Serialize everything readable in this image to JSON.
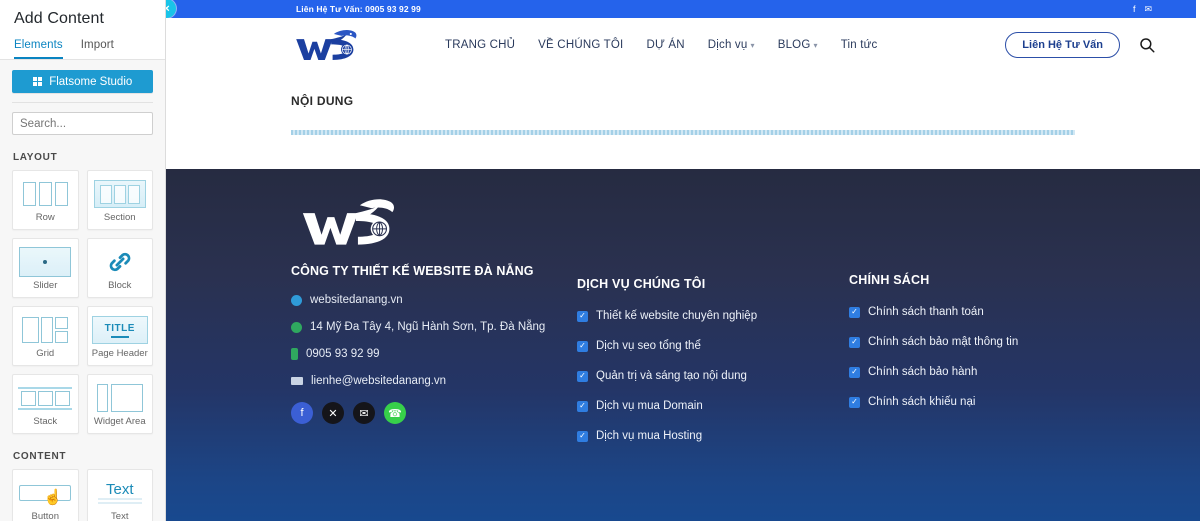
{
  "sidebar": {
    "title": "Add Content",
    "tabs": [
      {
        "label": "Elements",
        "active": true
      },
      {
        "label": "Import",
        "active": false
      }
    ],
    "studio_button": "Flatsome Studio",
    "search_placeholder": "Search...",
    "sections": [
      {
        "heading": "LAYOUT",
        "items": [
          {
            "label": "Row",
            "icon": "row-thumb-icon"
          },
          {
            "label": "Section",
            "icon": "section-thumb-icon"
          },
          {
            "label": "Slider",
            "icon": "slider-thumb-icon"
          },
          {
            "label": "Block",
            "icon": "link-thumb-icon"
          },
          {
            "label": "Grid",
            "icon": "grid-thumb-icon"
          },
          {
            "label": "Page Header",
            "icon": "page-header-thumb-icon"
          },
          {
            "label": "Stack",
            "icon": "stack-thumb-icon"
          },
          {
            "label": "Widget Area",
            "icon": "widget-area-thumb-icon"
          }
        ]
      },
      {
        "heading": "CONTENT",
        "items": [
          {
            "label": "Button",
            "icon": "button-thumb-icon"
          },
          {
            "label": "Text",
            "icon": "text-thumb-icon"
          }
        ]
      }
    ],
    "page_header_art_label": "TITLE",
    "text_art_label": "Text"
  },
  "preview": {
    "close_label": "×",
    "topbar": {
      "contact": "Liên Hệ Tư Vấn: 0905 93 92 99",
      "social": [
        "facebook-icon",
        "email-icon"
      ]
    },
    "nav": {
      "logo_alt": "wsd-logo",
      "items": [
        {
          "label": "TRANG CHỦ",
          "caret": false
        },
        {
          "label": "VỀ CHÚNG TÔI",
          "caret": false
        },
        {
          "label": "DỰ ÁN",
          "caret": false
        },
        {
          "label": "Dịch vụ",
          "caret": true
        },
        {
          "label": "BLOG",
          "caret": true
        },
        {
          "label": "Tin tức",
          "caret": false
        }
      ],
      "cta_label": "Liên Hệ Tư Vấn",
      "search_icon": "search-icon"
    },
    "content": {
      "title": "NỘI DUNG"
    }
  },
  "footer": {
    "logo_alt": "wsd-footer-logo",
    "company": "CÔNG TY THIẾT KẾ WEBSITE ĐÀ NẴNG",
    "contact_lines": [
      {
        "icon": "globe-icon",
        "text": "websitedanang.vn",
        "color": "#2f9bd8"
      },
      {
        "icon": "location-icon",
        "text": "14 Mỹ Đa Tây 4, Ngũ Hành Sơn, Tp. Đà Nẵng",
        "color": "#2fa85f"
      },
      {
        "icon": "phone-icon",
        "text": "0905 93 92 99",
        "color": "#2fa85f"
      },
      {
        "icon": "mail-icon",
        "text": "lienhe@websitedanang.vn",
        "color": "#c9d3e4"
      }
    ],
    "socials": [
      {
        "name": "facebook-icon",
        "glyph": "f",
        "bg": "#3b5fd4"
      },
      {
        "name": "x-twitter-icon",
        "glyph": "✕",
        "bg": "#15151a"
      },
      {
        "name": "email-icon",
        "glyph": "✉",
        "bg": "#15151a"
      },
      {
        "name": "phone-icon",
        "glyph": "☎",
        "bg": "#37d04a"
      }
    ],
    "columns": [
      {
        "heading": "DỊCH VỤ CHÚNG TÔI",
        "items": [
          "Thiết kế website chuyên nghiệp",
          "Dịch vụ seo tổng thể",
          "Quản trị và sáng tạo nội dung",
          "Dịch vụ mua Domain",
          "Dịch vụ mua Hosting"
        ]
      },
      {
        "heading": "CHÍNH SÁCH",
        "items": [
          "Chính sách thanh toán",
          "Chính sách bảo mật thông tin",
          "Chính sách bảo hành",
          "Chính sách khiếu nại"
        ]
      }
    ],
    "check_glyph": "✓"
  },
  "colors": {
    "accent_blue": "#1e9bd1",
    "topbar_blue": "#2563eb",
    "checkbox_blue": "#2f7de1"
  }
}
